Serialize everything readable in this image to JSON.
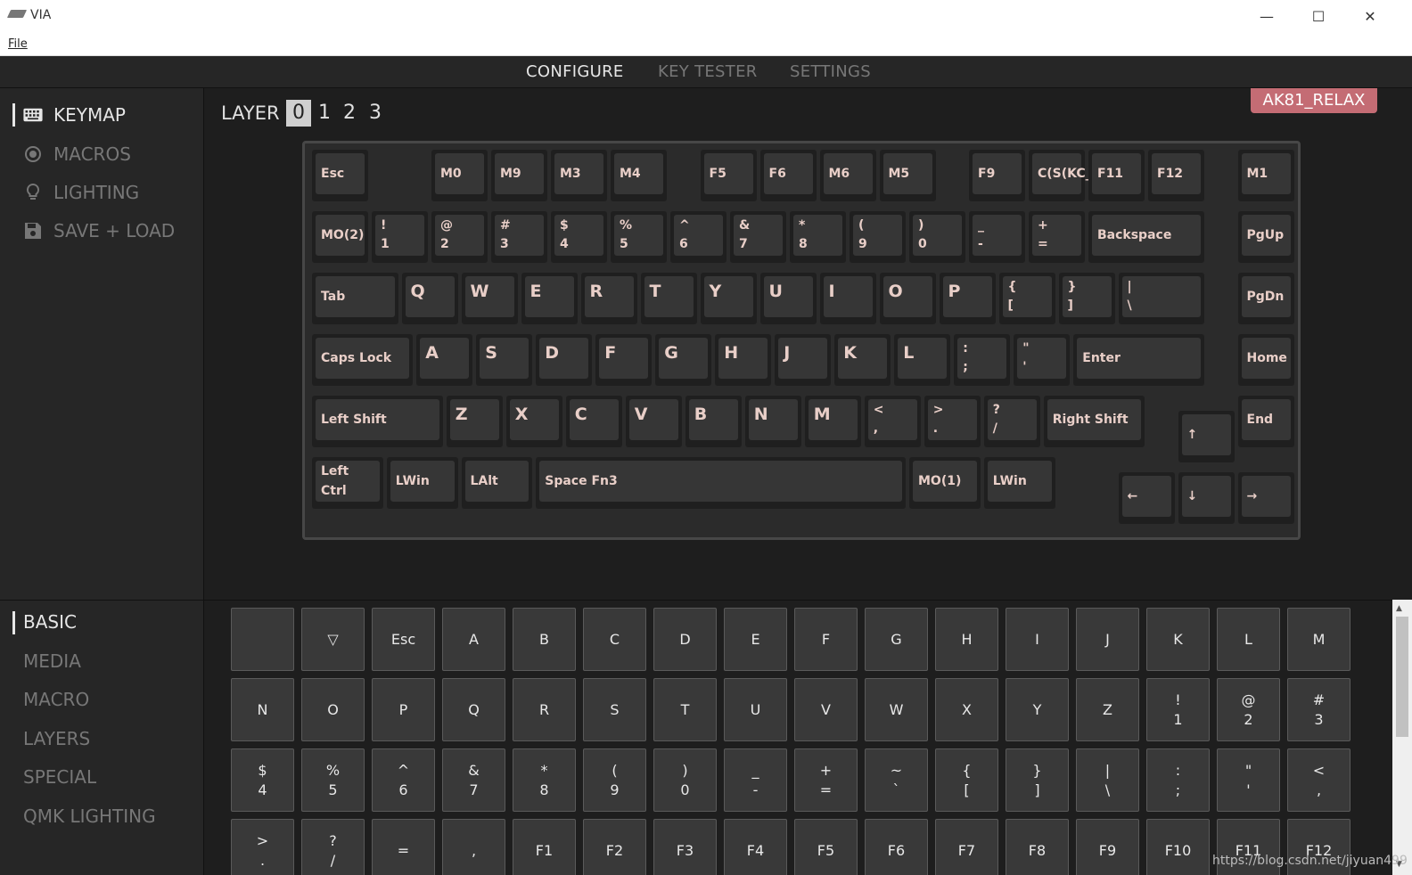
{
  "window": {
    "title": "VIA",
    "minimize": "—",
    "maximize": "☐",
    "close": "✕"
  },
  "menu": {
    "file": "File"
  },
  "topnav": {
    "configure": "CONFIGURE",
    "key_tester": "KEY TESTER",
    "settings": "SETTINGS"
  },
  "sidebar": {
    "items": [
      {
        "label": "KEYMAP",
        "icon": "keyboard-icon"
      },
      {
        "label": "MACROS",
        "icon": "record-icon"
      },
      {
        "label": "LIGHTING",
        "icon": "lightbulb-icon"
      },
      {
        "label": "SAVE + LOAD",
        "icon": "floppy-disk-icon"
      }
    ]
  },
  "layers": {
    "label": "LAYER",
    "numbers": [
      "0",
      "1",
      "2",
      "3"
    ],
    "active": "0"
  },
  "device": {
    "name": "AK81_RELAX"
  },
  "categories": [
    "BASIC",
    "MEDIA",
    "MACRO",
    "LAYERS",
    "SPECIAL",
    "QMK LIGHTING"
  ],
  "keymap": {
    "row0": [
      "Esc",
      "M0",
      "M9",
      "M3",
      "M4",
      "F5",
      "F6",
      "M6",
      "M5",
      "F9",
      "C(S(KC_",
      "F11",
      "F12",
      "M1"
    ],
    "row1": [
      "MO(2)",
      "!\n1",
      "@\n2",
      "#\n3",
      "$\n4",
      "%\n5",
      "^\n6",
      "&\n7",
      "*\n8",
      "(\n9",
      ")\n0",
      "_\n-",
      "+\n=",
      "Backspace",
      "PgUp"
    ],
    "row2": [
      "Tab",
      "Q",
      "W",
      "E",
      "R",
      "T",
      "Y",
      "U",
      "I",
      "O",
      "P",
      "{\n[",
      "}\n]",
      "|\n\\",
      "PgDn"
    ],
    "row3": [
      "Caps Lock",
      "A",
      "S",
      "D",
      "F",
      "G",
      "H",
      "J",
      "K",
      "L",
      ":\n;",
      "\"\n'",
      "Enter",
      "Home"
    ],
    "row4": [
      "Left Shift",
      "Z",
      "X",
      "C",
      "V",
      "B",
      "N",
      "M",
      "<\n,",
      ">\n.",
      "?\n/",
      "Right Shift",
      "↑",
      "End"
    ],
    "row5": [
      "Left Ctrl",
      "LWin",
      "LAlt",
      "Space Fn3",
      "MO(1)",
      "LWin",
      "←",
      "↓",
      "→"
    ]
  },
  "picker": {
    "keys": [
      "",
      "▽",
      "Esc",
      "A",
      "B",
      "C",
      "D",
      "E",
      "F",
      "G",
      "H",
      "I",
      "J",
      "K",
      "L",
      "M",
      "N",
      "O",
      "P",
      "Q",
      "R",
      "S",
      "T",
      "U",
      "V",
      "W",
      "X",
      "Y",
      "Z",
      "!\n1",
      "@\n2",
      "#\n3",
      "$\n4",
      "%\n5",
      "^\n6",
      "&\n7",
      "*\n8",
      "(\n9",
      ")\n0",
      "_\n-",
      "+\n=",
      "~\n`",
      "{\n[",
      "}\n]",
      "|\n\\",
      ":\n;",
      "\"\n'",
      "<\n,",
      ">\n.",
      "?\n/",
      "=",
      ",",
      "F1",
      "F2",
      "F3",
      "F4",
      "F5",
      "F6",
      "F7",
      "F8",
      "F9",
      "F10",
      "F11",
      "F12"
    ]
  },
  "watermark": "https://blog.csdn.net/jiyuan499"
}
